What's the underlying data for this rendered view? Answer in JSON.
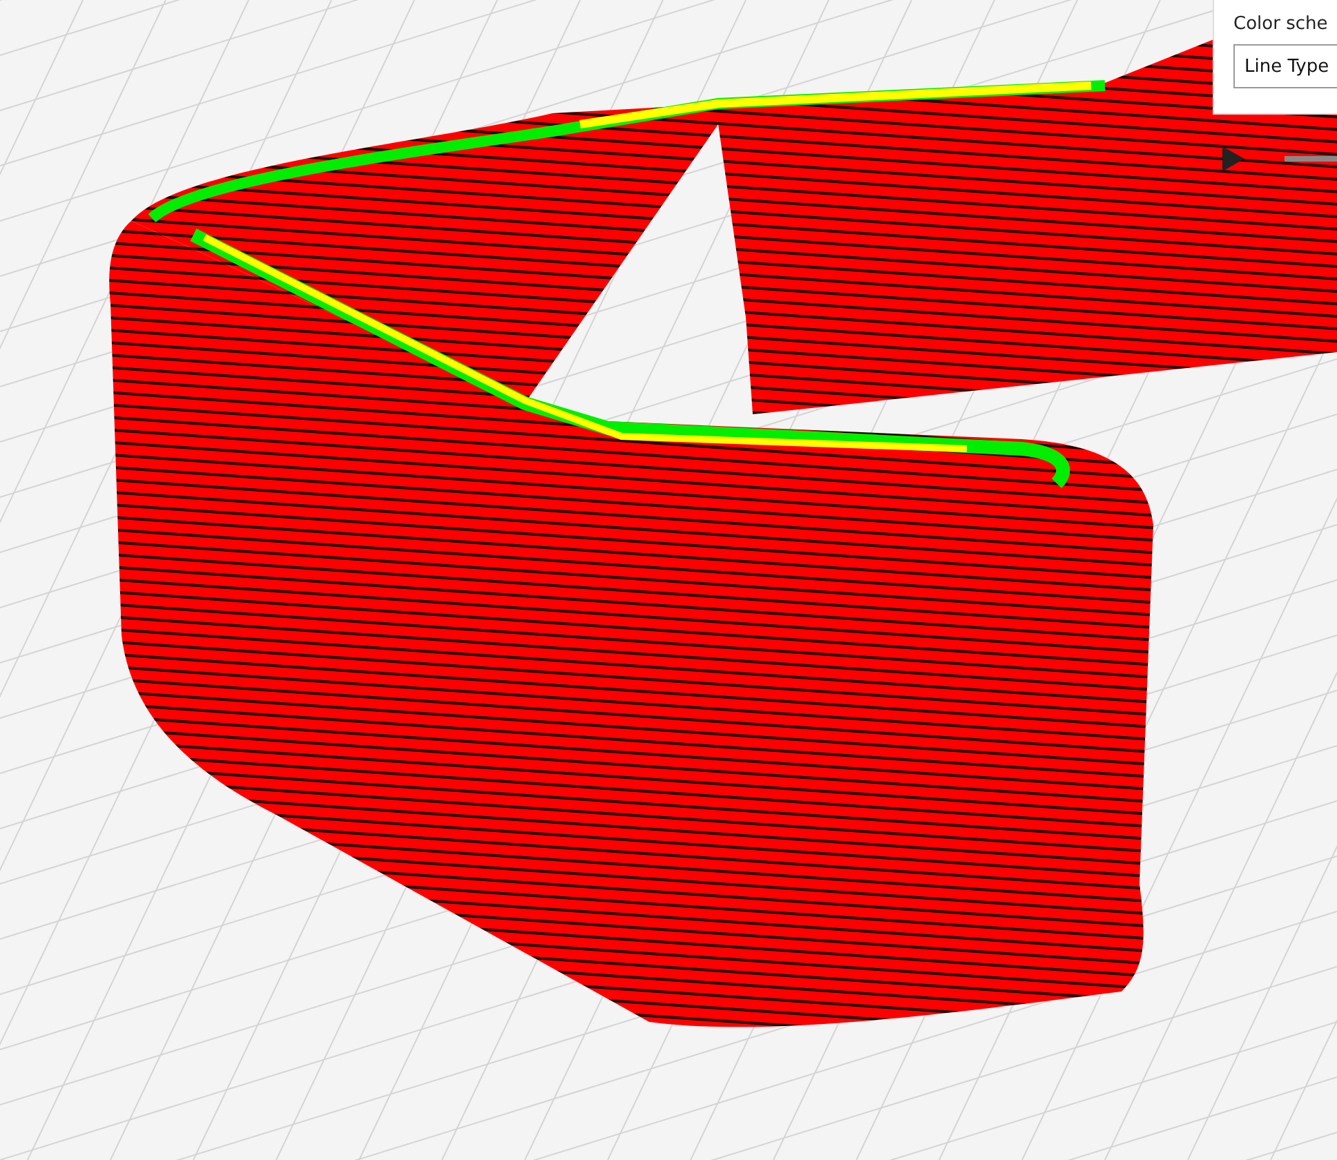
{
  "color_scheme": {
    "label": "Color sche",
    "value": "Line Type"
  }
}
